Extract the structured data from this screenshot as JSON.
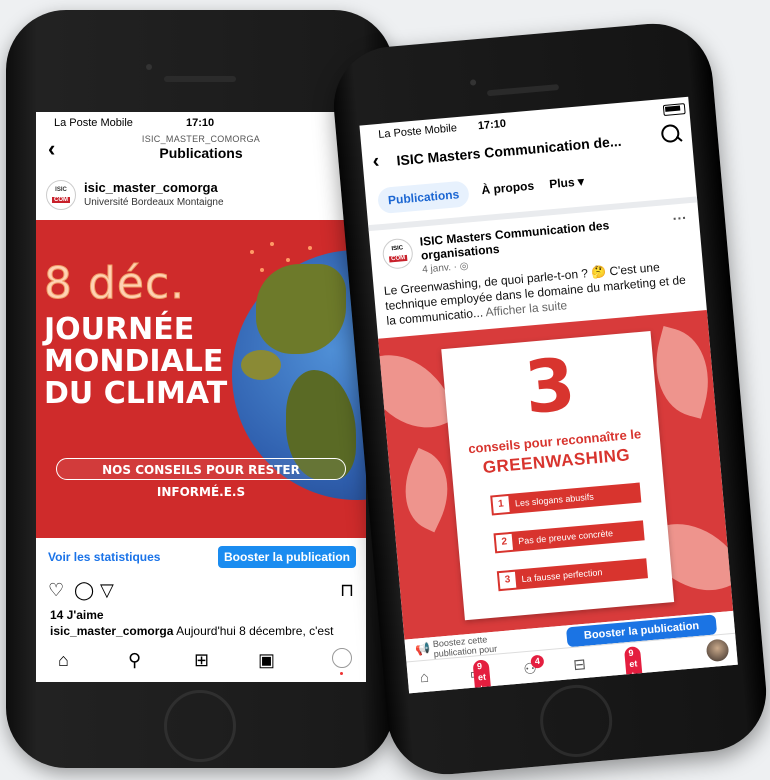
{
  "instagram": {
    "status": {
      "carrier": "La Poste Mobile",
      "time": "17:10"
    },
    "header": {
      "username": "ISIC_MASTER_COMORGA",
      "title": "Publications"
    },
    "post": {
      "username": "isic_master_comorga",
      "subtitle": "Université Bordeaux Montaigne",
      "avatar_text_top": "ISIC",
      "avatar_text_bottom": "COM",
      "image": {
        "date": "8 déc.",
        "headline_1": "JOURNÉE",
        "headline_2": "MONDIALE",
        "headline_3": "DU CLIMAT",
        "banner": "NOS CONSEILS POUR RESTER INFORMÉ.E.S"
      },
      "stats_link": "Voir les statistiques",
      "boost_button": "Booster la publication",
      "likes": "14 J'aime",
      "caption_user": "isic_master_comorga",
      "caption_text": "Aujourd'hui 8 décembre, c'est"
    }
  },
  "facebook": {
    "status": {
      "carrier": "La Poste Mobile",
      "time": "17:10"
    },
    "header": {
      "title": "ISIC Masters Communication de..."
    },
    "tabs": [
      "Publications",
      "À propos",
      "Plus ▾"
    ],
    "post": {
      "page_name": "ISIC Masters Communication des organisations",
      "date": "4 janv. · ◎",
      "text": "Le Greenwashing, de quoi parle-t-on ? 🤔 C'est une technique employée dans le domaine du marketing et de la communicatio...",
      "see_more": "Afficher la suite",
      "image": {
        "number": "3",
        "subtitle": "conseils pour reconnaître le",
        "title": "GREENWASHING",
        "tips": [
          {
            "n": "1",
            "label": "Les slogans abusifs"
          },
          {
            "n": "2",
            "label": "Pas de preuve concrète"
          },
          {
            "n": "3",
            "label": "La fausse perfection"
          }
        ]
      },
      "boost_text": "Boostez cette publication pour",
      "boost_button": "Booster la publication"
    },
    "nav": {
      "badge_1": "9 et +",
      "badge_2": "4",
      "badge_3": "9 et +"
    }
  },
  "colors": {
    "instagram_red": "#cf2b2b",
    "instagram_blue": "#1a8cf0",
    "facebook_blue": "#1b74e4",
    "facebook_red": "#d8342e"
  }
}
